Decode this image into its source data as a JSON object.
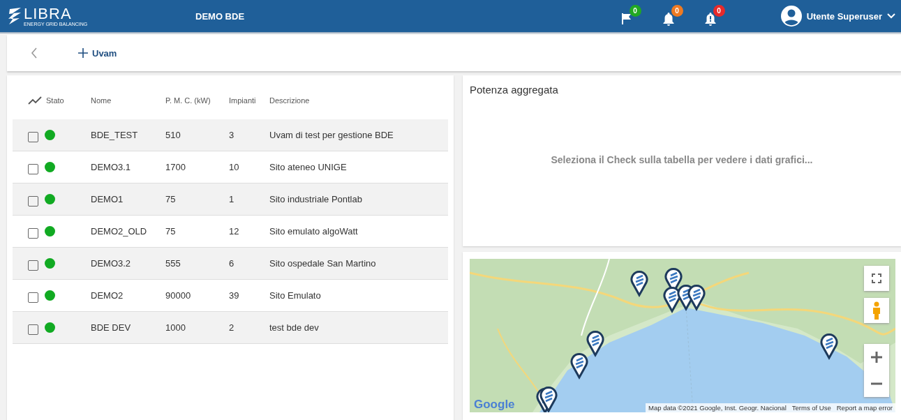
{
  "header": {
    "logo": {
      "name": "LIBRA",
      "tagline": "ENERGY GRID BALANCING"
    },
    "title": "DEMO BDE",
    "notifications": [
      {
        "kind": "flag",
        "count": "0",
        "color": "#22a822"
      },
      {
        "kind": "bell",
        "count": "0",
        "color": "#ee7a22"
      },
      {
        "kind": "alert",
        "count": "0",
        "color": "#e82a2a"
      }
    ],
    "user": "Utente Superuser"
  },
  "toolbar": {
    "add_label": "Uvam"
  },
  "table": {
    "status_column": "Stato",
    "columns": [
      "Nome",
      "P. M. C. (kW)",
      "Impianti",
      "Descrizione"
    ],
    "rows": [
      {
        "checked": false,
        "color": "#11aa22",
        "cells": [
          "BDE_TEST",
          "510",
          "3",
          "Uvam di test per gestione BDE"
        ]
      },
      {
        "checked": false,
        "color": "#11aa22",
        "cells": [
          "DEMO3.1",
          "1700",
          "10",
          "Sito ateneo UNIGE"
        ]
      },
      {
        "checked": false,
        "color": "#11aa22",
        "cells": [
          "DEMO1",
          "75",
          "1",
          "Sito industriale Pontlab"
        ]
      },
      {
        "checked": false,
        "color": "#11aa22",
        "cells": [
          "DEMO2_OLD",
          "75",
          "12",
          "Sito emulato algoWatt"
        ]
      },
      {
        "checked": false,
        "color": "#11aa22",
        "cells": [
          "DEMO3.2",
          "555",
          "6",
          "Sito ospedale San Martino"
        ]
      },
      {
        "checked": false,
        "color": "#11aa22",
        "cells": [
          "DEMO2",
          "90000",
          "39",
          "Sito Emulato"
        ]
      },
      {
        "checked": false,
        "color": "#11aa22",
        "cells": [
          "BDE DEV",
          "1000",
          "2",
          "test bde dev"
        ]
      }
    ]
  },
  "chart_panel": {
    "title": "Potenza aggregata",
    "empty_message": "Seleziona il Check sulla tabella per vedere i dati grafici..."
  },
  "map": {
    "kind": "picture",
    "google_logo": "Google",
    "attribution": [
      "Map data ©2021 Google, Inst. Geogr. Nacional",
      "Terms of Use",
      "Report a map error"
    ]
  }
}
